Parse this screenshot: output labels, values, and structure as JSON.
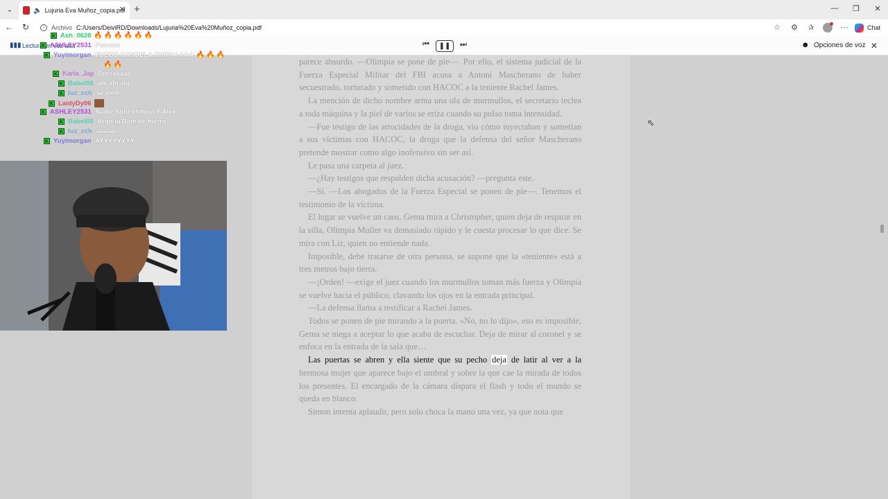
{
  "browser": {
    "tab_title": "Lujuria Eva Muñoz_copia.pdf",
    "tab_close": "✕",
    "new_tab": "+",
    "omnibox_label": "Archivo",
    "url": "C:/Users/DeiviRD/Downloads/Lujuria%20Eva%20Muñoz_copia.pdf",
    "chat_label": "Chat"
  },
  "readbar": {
    "label": "Lectura en voz alta",
    "voice_options": "Opciones de voz"
  },
  "page": {
    "paragraphs": [
      {
        "text": "parece absurdo. —Olimpia se pone de pie—. Por ello, el sistema judicial de la Fuerza Especial Militar del FBI acusa a Antoni Mascherano de haber secuestrado, torturado y sometido con HACOC a la teniente Rachel James.",
        "cont": true
      },
      {
        "text": "La mención de dicho nombre arma una ola de murmullos, el secretario teclea a toda máquina y la piel de varios se eriza cuando su pulso toma intensidad."
      },
      {
        "text": "—Fue testigo de las atrocidades de la droga, vio cómo inyectaban y sometían a sus víctimas con HACOC, la droga que la defensa del señor Mascherano pretende mostrar como algo inofensivo sin ser así."
      },
      {
        "text": "Le pasa una carpeta al juez."
      },
      {
        "text": "—¿Hay testigos que respalden dicha acusación? —pregunta este."
      },
      {
        "text": "—Sí. —Los abogados de la Fuerza Especial se ponen de pie—. Tenemos el testimonio de la víctima."
      },
      {
        "text": "El lugar se vuelve un caos, Gema mira a Christopher, quien deja de respirar en la silla, Olimpia Muller va demasiado rápido y le cuesta procesar lo que dice. Se mira con Liz, quien no entiende nada."
      },
      {
        "text": "Imposible, debe tratarse de otra persona, se supone que la «teniente» está a tres metros bajo tierra."
      },
      {
        "text": "—¡Orden! —exige el juez cuando los murmullos toman más fuerza y Olimpia se vuelve hacia el público, clavando los ojos en la entrada principal."
      },
      {
        "text": "—La defensa llama a testificar a Rachel James."
      },
      {
        "text": "Todos se ponen de pie mirando a la puerta. «No, no lo dijo», eso es imposible, Gema se niega a aceptar lo que acaba de escuchar. Deja de mirar al coronel y se enfoca en la entrada de la sala que…"
      }
    ],
    "active_before": "Las puertas se abren y ella siente que su pecho ",
    "active_word": "deja",
    "active_after": " de latir al ver a la",
    "active_rest": "hermosa mujer que aparece bajo el umbral y sobre la que cae la mirada de todos los presentes. El encargado de la cámara dispara el flash y todo el mundo se queda en blanco.",
    "last_paragraph": "Simon intenta aplaudir, pero solo choca la mano una vez, ya que nota que"
  },
  "chat": [
    {
      "user": "Ash_0628",
      "color": "#2ecc71",
      "msg": "",
      "emotes": "🔥🔥🔥🔥🔥🔥"
    },
    {
      "user": "ASHLEY2531",
      "color": "#b24cd6",
      "msg": "Pooooo",
      "emotes": ""
    },
    {
      "user": "Yuyimorgan",
      "color": "#7e7ad8",
      "msg": "FUEGO CANDELA CHIPAAAAA",
      "emotes": "🔥🔥🔥"
    },
    {
      "user": "",
      "color": "#fff",
      "msg": "",
      "emotes": "🔥🔥"
    },
    {
      "user": "Karla_Jap",
      "color": "#c27bd6",
      "msg": "Diosaaaaa",
      "emotes": ""
    },
    {
      "user": "Babel08",
      "color": "#5ad1b1",
      "msg": "ahi ahi ahi",
      "emotes": ""
    },
    {
      "user": "luz_cch",
      "color": "#7aa7d8",
      "msg": "se vino",
      "emotes": ""
    },
    {
      "user": "LaidyDy06",
      "color": "#d84c6a",
      "msg": "",
      "emotes": ""
    },
    {
      "user": "ASHLEY2531",
      "color": "#b24cd6",
      "msg": "Nadie Solo olimpia Y Alex",
      "emotes": ""
    },
    {
      "user": "Babel08",
      "color": "#5ad1b1",
      "msg": "llego la Dam de hierro",
      "emotes": ""
    },
    {
      "user": "luz_cch",
      "color": "#7aa7d8",
      "msg": "aaaaa",
      "emotes": ""
    },
    {
      "user": "Yuyimorgan",
      "color": "#7e7ad8",
      "msg": "AYYYYYYYY",
      "emotes": ""
    }
  ],
  "badge_letter": "K",
  "icons": {
    "pdf": "pdf-icon",
    "speaker": "speaker-icon",
    "back": "arrow-left-icon",
    "refresh": "refresh-icon",
    "star": "star-icon",
    "extensions": "puzzle-icon",
    "favorites": "favorites-icon",
    "menu": "more-icon",
    "prev": "skip-back-icon",
    "pause": "pause-icon",
    "next": "skip-forward-icon",
    "voice": "voice-icon",
    "close": "close-icon"
  }
}
